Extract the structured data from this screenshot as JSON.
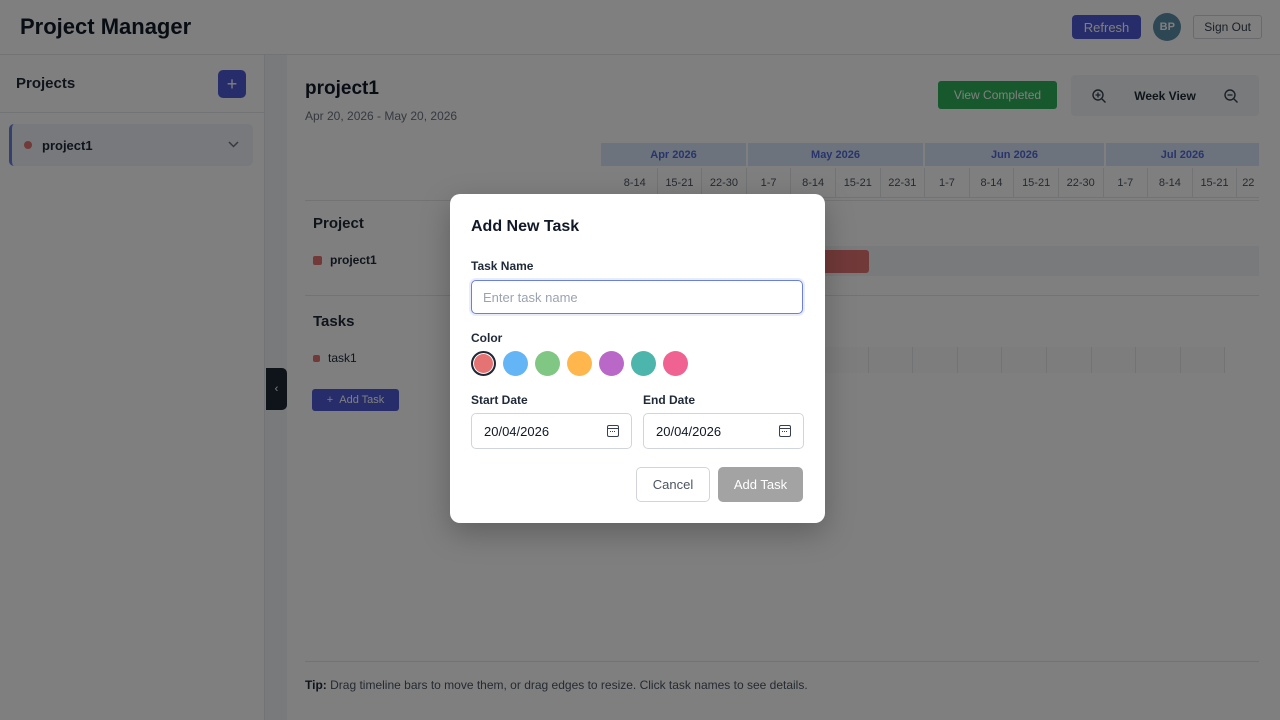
{
  "header": {
    "app_title": "Project Manager",
    "refresh_label": "Refresh",
    "avatar_initials": "BP",
    "signout_label": "Sign Out"
  },
  "sidebar": {
    "title": "Projects",
    "add_icon": "plus-icon",
    "items": [
      {
        "label": "project1",
        "color": "#e57373",
        "expanded_icon": "chevron-down-icon"
      }
    ]
  },
  "main": {
    "project_title": "project1",
    "project_dates": "Apr 20, 2026 - May 20, 2026",
    "view_completed_label": "View Completed",
    "zoom_in_icon": "zoom-in-icon",
    "zoom_out_icon": "zoom-out-icon",
    "view_label": "Week View",
    "months": [
      "Apr 2026",
      "May 2026",
      "Jun 2026",
      "Jul 2026"
    ],
    "weeks": [
      "8-14",
      "15-21",
      "22-30",
      "1-7",
      "8-14",
      "15-21",
      "22-31",
      "1-7",
      "8-14",
      "15-21",
      "22-30",
      "1-7",
      "8-14",
      "15-21",
      "22"
    ],
    "project_section_title": "Project",
    "project_row_label": "project1",
    "tasks_section_title": "Tasks",
    "task_rows": [
      "task1"
    ],
    "add_task_label": "Add Task",
    "tip_label": "Tip:",
    "tip_text": " Drag timeline bars to move them, or drag edges to resize. Click task names to see details."
  },
  "modal": {
    "title": "Add New Task",
    "task_name_label": "Task Name",
    "task_name_value": "",
    "task_name_placeholder": "Enter task name",
    "color_label": "Color",
    "colors": [
      "#e57373",
      "#64b5f6",
      "#81c784",
      "#ffb74d",
      "#ba68c8",
      "#4db6ac",
      "#f06292"
    ],
    "selected_color": "#e57373",
    "start_date_label": "Start Date",
    "start_date_value": "20/04/2026",
    "end_date_label": "End Date",
    "end_date_value": "20/04/2026",
    "calendar_icon": "calendar-icon",
    "cancel_label": "Cancel",
    "submit_label": "Add Task"
  }
}
